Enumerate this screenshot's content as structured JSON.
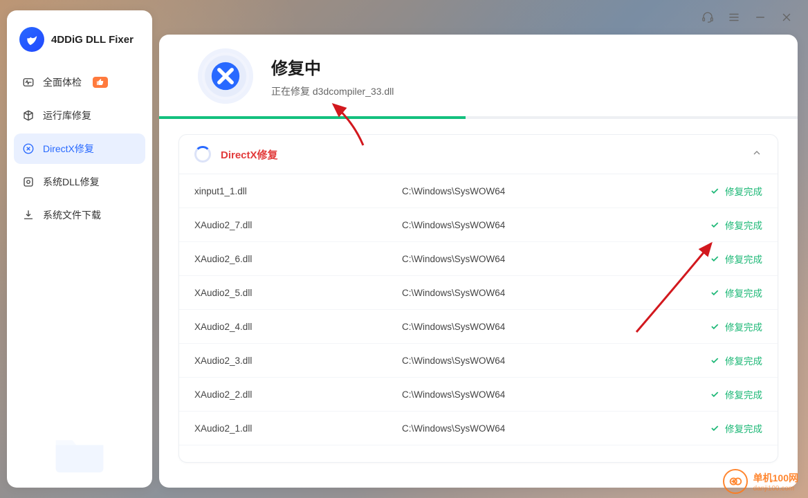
{
  "app": {
    "name": "4DDiG DLL Fixer"
  },
  "sidebar": {
    "items": [
      {
        "label": "全面体检",
        "icon": "heartbeat-icon",
        "badge": true
      },
      {
        "label": "运行库修复",
        "icon": "package-icon"
      },
      {
        "label": "DirectX修复",
        "icon": "close-circle-icon",
        "active": true
      },
      {
        "label": "系统DLL修复",
        "icon": "cube-icon"
      },
      {
        "label": "系统文件下载",
        "icon": "download-icon"
      }
    ]
  },
  "status": {
    "title": "修复中",
    "prefix": "正在修复 ",
    "current": "d3dcompiler_33.dll",
    "progress_percent": 48
  },
  "panel": {
    "title": "DirectX修复",
    "status_label": "修复完成",
    "rows": [
      {
        "file": "xinput1_1.dll",
        "path": "C:\\Windows\\SysWOW64"
      },
      {
        "file": "XAudio2_7.dll",
        "path": "C:\\Windows\\SysWOW64"
      },
      {
        "file": "XAudio2_6.dll",
        "path": "C:\\Windows\\SysWOW64"
      },
      {
        "file": "XAudio2_5.dll",
        "path": "C:\\Windows\\SysWOW64"
      },
      {
        "file": "XAudio2_4.dll",
        "path": "C:\\Windows\\SysWOW64"
      },
      {
        "file": "XAudio2_3.dll",
        "path": "C:\\Windows\\SysWOW64"
      },
      {
        "file": "XAudio2_2.dll",
        "path": "C:\\Windows\\SysWOW64"
      },
      {
        "file": "XAudio2_1.dll",
        "path": "C:\\Windows\\SysWOW64"
      }
    ]
  },
  "watermark": {
    "brand": "单机100网",
    "url": "danji100.com"
  },
  "colors": {
    "accent": "#2869ff",
    "success": "#1eb877",
    "danger": "#e23b3b",
    "badge": "#ff7a3d"
  }
}
